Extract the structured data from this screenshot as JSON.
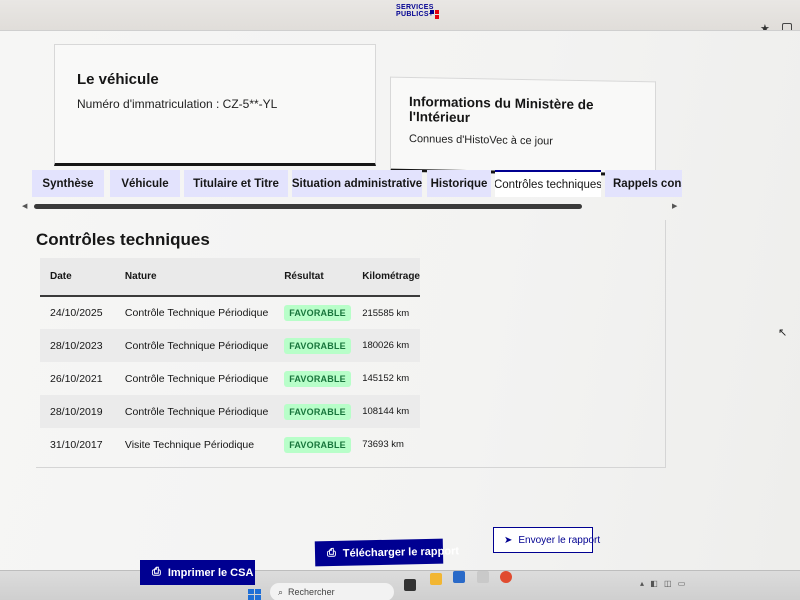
{
  "browser": {
    "logo_line1": "SERVICES",
    "logo_line2": "PUBLICS+"
  },
  "vehicle_card": {
    "title": "Le véhicule",
    "plate_label": "Numéro d'immatriculation : CZ-5**-YL"
  },
  "info_card": {
    "title": "Informations du Ministère de l'Intérieur",
    "subtitle": "Connues d'HistoVec à ce jour"
  },
  "tabs": [
    {
      "label": "Synthèse"
    },
    {
      "label": "Véhicule"
    },
    {
      "label": "Titulaire et Titre"
    },
    {
      "label": "Situation administrative"
    },
    {
      "label": "Historique"
    },
    {
      "label": "Contrôles techniques"
    },
    {
      "label": "Rappels construc"
    }
  ],
  "panel": {
    "title": "Contrôles techniques",
    "columns": [
      "Date",
      "Nature",
      "Résultat",
      "Kilométrage"
    ],
    "rows": [
      {
        "date": "24/10/2025",
        "nature": "Contrôle Technique Périodique",
        "result": "FAVORABLE",
        "km": "215585 km"
      },
      {
        "date": "28/10/2023",
        "nature": "Contrôle Technique Périodique",
        "result": "FAVORABLE",
        "km": "180026 km"
      },
      {
        "date": "26/10/2021",
        "nature": "Contrôle Technique Périodique",
        "result": "FAVORABLE",
        "km": "145152 km"
      },
      {
        "date": "28/10/2019",
        "nature": "Contrôle Technique Périodique",
        "result": "FAVORABLE",
        "km": "108144 km"
      },
      {
        "date": "31/10/2017",
        "nature": "Visite Technique Périodique",
        "result": "FAVORABLE",
        "km": "73693 km"
      }
    ]
  },
  "actions": {
    "print": "Imprimer le CSA",
    "download": "Télécharger le rapport",
    "send": "Envoyer le rapport"
  },
  "taskbar": {
    "search_placeholder": "Rechercher"
  },
  "icons": {
    "bookmark": "star-icon",
    "extensions": "puzzle-icon",
    "print": "printer-icon",
    "send": "paper-plane-icon",
    "windows": "windows-logo-icon",
    "search": "magnifier-icon"
  },
  "colors": {
    "primary": "#000091",
    "tab_bg": "#e3e3fd",
    "badge_bg": "#b8fec9",
    "badge_text": "#18753c"
  }
}
